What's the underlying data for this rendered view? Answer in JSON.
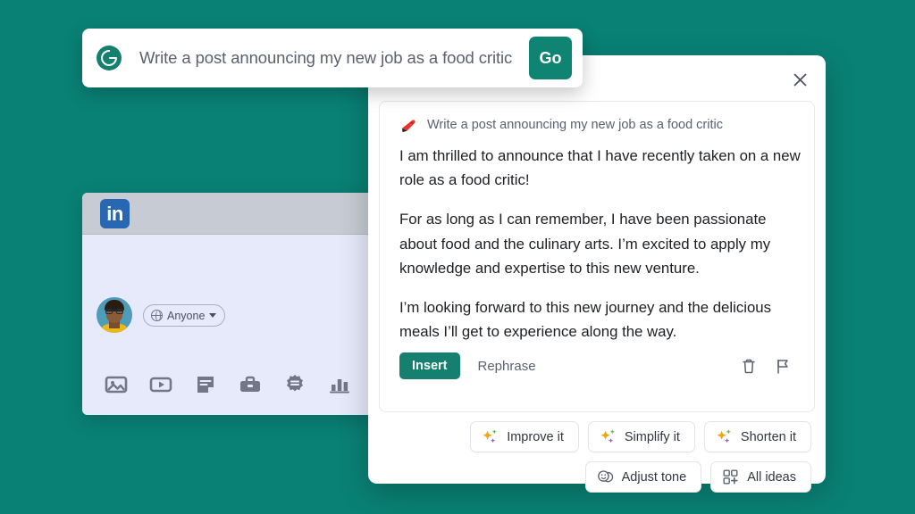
{
  "background_color": "#0a8175",
  "prompt_bar": {
    "logo_icon": "grammarly-g-icon",
    "text": "Write a post announcing my new job as a food critic",
    "go_label": "Go",
    "go_color": "#0f8473"
  },
  "linkedin_window": {
    "logo_text": "in",
    "logo_color": "#2867b2",
    "audience_chip": {
      "icon": "globe-icon",
      "label": "Anyone",
      "caret": "chevron-down-icon"
    },
    "composer_icons": [
      {
        "name": "image-icon",
        "label": "Add a photo"
      },
      {
        "name": "video-icon",
        "label": "Add a video"
      },
      {
        "name": "document-icon",
        "label": "Add a document"
      },
      {
        "name": "briefcase-icon",
        "label": "Share a job"
      },
      {
        "name": "celebrate-icon",
        "label": "Celebrate an occasion"
      },
      {
        "name": "poll-icon",
        "label": "Create a poll"
      }
    ]
  },
  "result_card": {
    "close_icon": "close-icon",
    "echo": {
      "icon": "marker-icon",
      "text": "Write a post announcing my new job as a food critic"
    },
    "post_paragraphs": [
      "I am thrilled to announce that I have recently taken on a new role as a food critic!",
      "For as long as I can remember, I have been passionate about food and the culinary arts. I’m excited to apply my knowledge and expertise to this new venture.",
      "I’m looking forward to this new journey and the delicious meals I’ll get to experience along the way."
    ],
    "actions": {
      "insert_label": "Insert",
      "insert_color": "#15806f",
      "rephrase_label": "Rephrase",
      "delete_icon": "trash-icon",
      "flag_icon": "flag-icon"
    },
    "suggestion_chips": [
      {
        "icon": "sparkles-icon",
        "label": "Improve it"
      },
      {
        "icon": "sparkles-icon",
        "label": "Simplify it"
      },
      {
        "icon": "sparkles-icon",
        "label": "Shorten it"
      },
      {
        "icon": "tone-faces-icon",
        "label": "Adjust tone"
      },
      {
        "icon": "grid-plus-icon",
        "label": "All ideas"
      }
    ]
  }
}
